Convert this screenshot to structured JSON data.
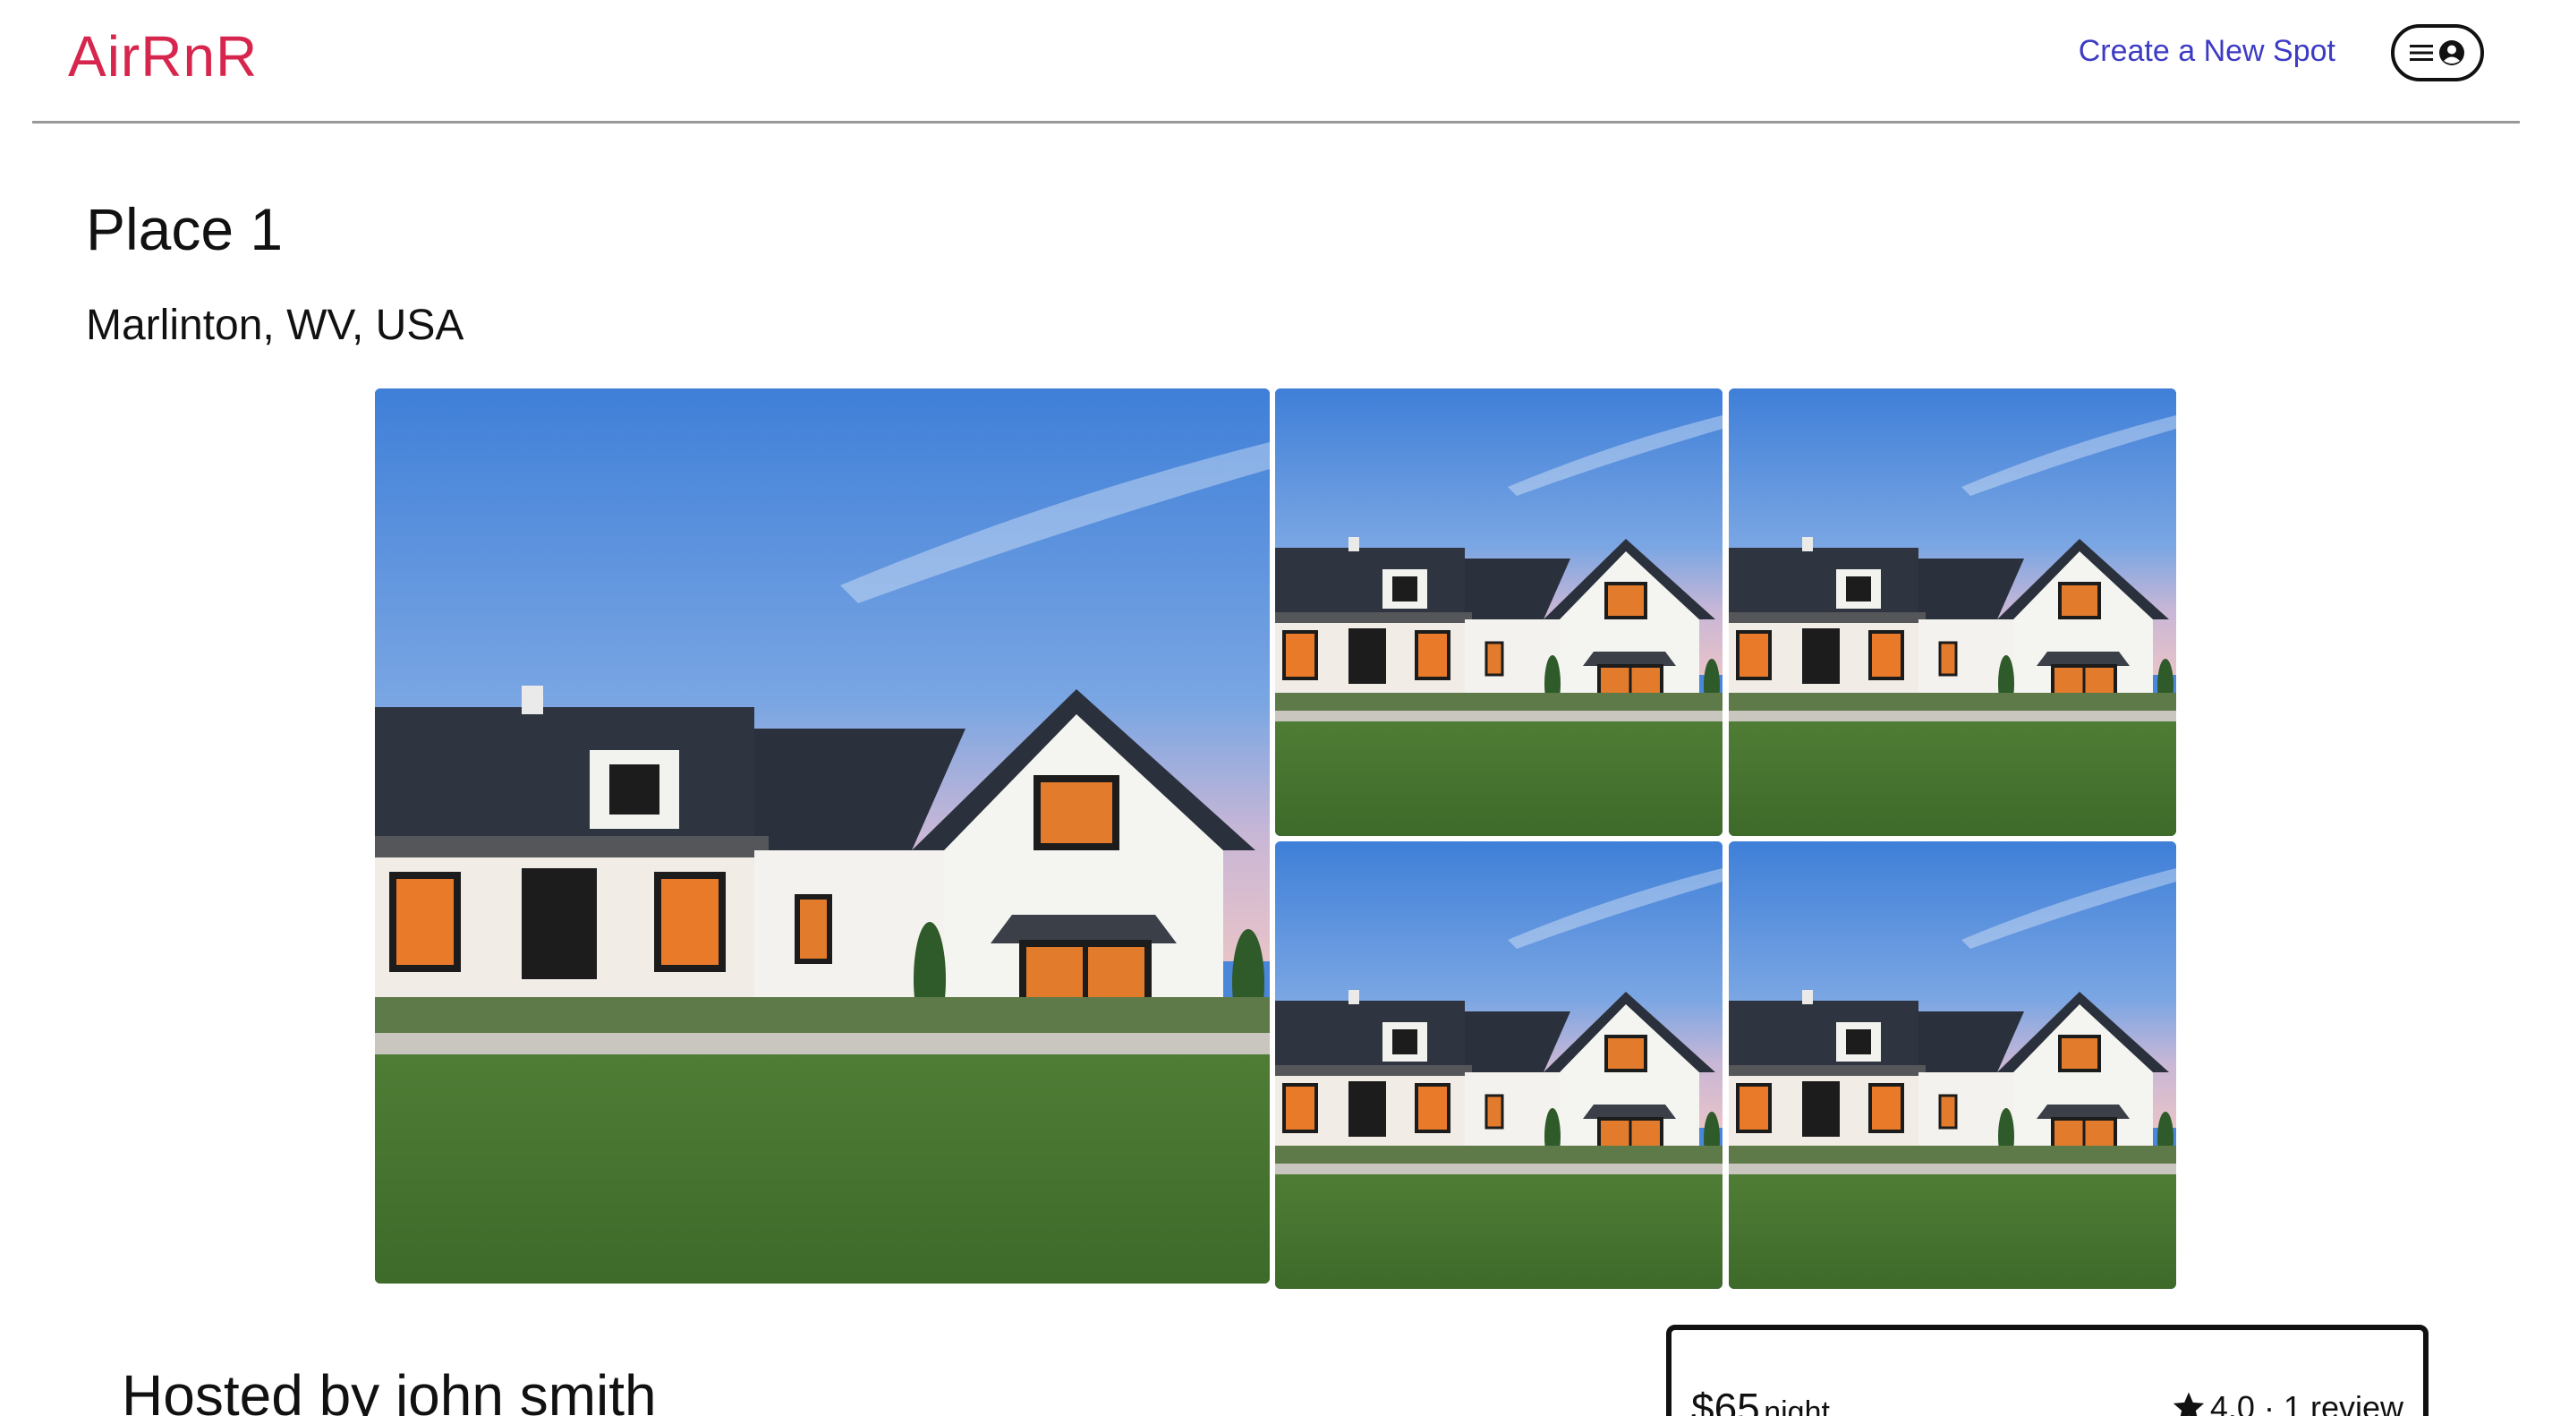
{
  "header": {
    "logo": "AirRnR",
    "create_spot_label": "Create a New Spot",
    "profile_menu": {
      "icons": [
        "menu-icon",
        "user-circle-icon"
      ]
    }
  },
  "spot": {
    "name": "Place 1",
    "location": "Marlinton, WV, USA",
    "images": [
      "house-photo",
      "house-photo",
      "house-photo",
      "house-photo",
      "house-photo"
    ]
  },
  "host": {
    "label": "Hosted by john smith"
  },
  "booking": {
    "price": "$65",
    "unit": "night",
    "rating": "4.0 · 1 review"
  },
  "colors": {
    "brand": "#d7264e",
    "link": "#3d3bc4",
    "text": "#111111"
  }
}
